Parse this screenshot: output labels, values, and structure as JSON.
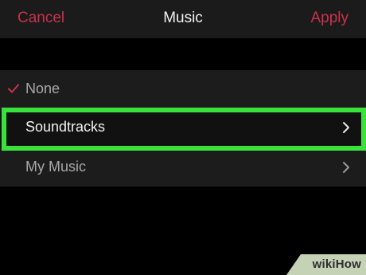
{
  "nav": {
    "cancel_label": "Cancel",
    "title": "Music",
    "apply_label": "Apply"
  },
  "list": {
    "items": [
      {
        "label": "None",
        "selected": true,
        "icon": "checkmark-icon"
      },
      {
        "label": "Soundtracks",
        "selected": false,
        "icon": "chevron-right-icon"
      },
      {
        "label": "My Music",
        "selected": false,
        "icon": "chevron-right-icon"
      }
    ]
  },
  "watermark": {
    "text": "wikiHow"
  },
  "colors": {
    "accent": "#c9324e",
    "highlight": "#39e23a",
    "background": "#000000",
    "bar": "#1b1b1b"
  }
}
